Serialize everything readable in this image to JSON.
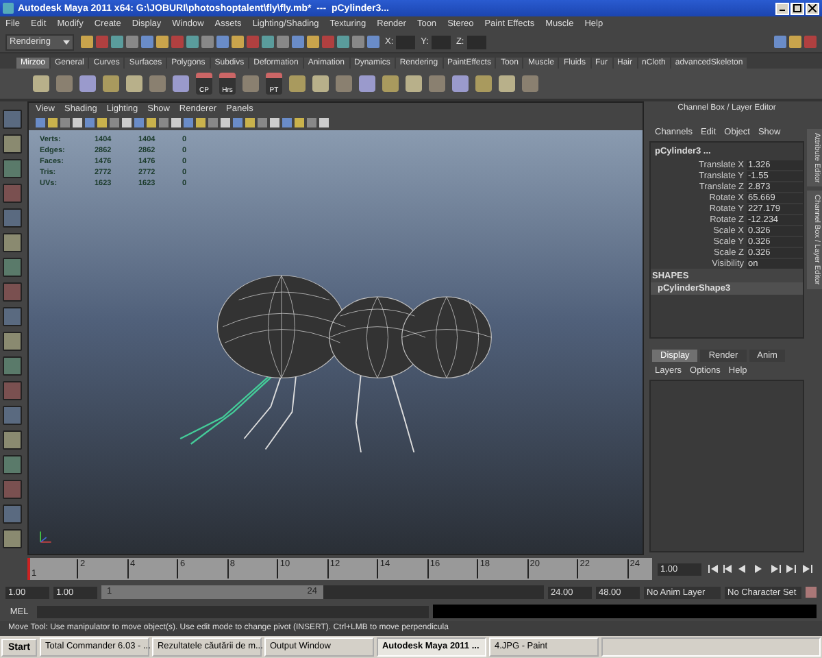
{
  "window": {
    "title": "Autodesk Maya 2011 x64: G:\\JOBURI\\photoshoptalent\\fly\\fly.mb*  ---  pCylinder3..."
  },
  "menu": [
    "File",
    "Edit",
    "Modify",
    "Create",
    "Display",
    "Window",
    "Assets",
    "Lighting/Shading",
    "Texturing",
    "Render",
    "Toon",
    "Stereo",
    "Paint Effects",
    "Muscle",
    "Help"
  ],
  "status_line": {
    "menu_set": "Rendering",
    "x_label": "X:",
    "y_label": "Y:",
    "z_label": "Z:"
  },
  "shelf": {
    "tabs": [
      {
        "label": "Mirzoo",
        "selected": true
      },
      {
        "label": "General",
        "selected": false
      },
      {
        "label": "Curves",
        "selected": false
      },
      {
        "label": "Surfaces",
        "selected": false
      },
      {
        "label": "Polygons",
        "selected": false
      },
      {
        "label": "Subdivs",
        "selected": false
      },
      {
        "label": "Deformation",
        "selected": false
      },
      {
        "label": "Animation",
        "selected": false
      },
      {
        "label": "Dynamics",
        "selected": false
      },
      {
        "label": "Rendering",
        "selected": false
      },
      {
        "label": "PaintEffects",
        "selected": false
      },
      {
        "label": "Toon",
        "selected": false
      },
      {
        "label": "Muscle",
        "selected": false
      },
      {
        "label": "Fluids",
        "selected": false
      },
      {
        "label": "Fur",
        "selected": false
      },
      {
        "label": "Hair",
        "selected": false
      },
      {
        "label": "nCloth",
        "selected": false
      },
      {
        "label": "advancedSkeleton",
        "selected": false
      }
    ],
    "button_labels": [
      "CP",
      "Hrs",
      "PT"
    ]
  },
  "viewport": {
    "menu": [
      "View",
      "Shading",
      "Lighting",
      "Show",
      "Renderer",
      "Panels"
    ],
    "stats": [
      {
        "name": "Verts:",
        "values": [
          "1404",
          "1404",
          "0"
        ]
      },
      {
        "name": "Edges:",
        "values": [
          "2862",
          "2862",
          "0"
        ]
      },
      {
        "name": "Faces:",
        "values": [
          "1476",
          "1476",
          "0"
        ]
      },
      {
        "name": "Tris:",
        "values": [
          "2772",
          "2772",
          "0"
        ]
      },
      {
        "name": "UVs:",
        "values": [
          "1623",
          "1623",
          "0"
        ]
      }
    ]
  },
  "channel_box": {
    "title": "Channel Box / Layer Editor",
    "menu": [
      "Channels",
      "Edit",
      "Object",
      "Show"
    ],
    "object": "pCylinder3 ...",
    "channels": [
      {
        "name": "Translate X",
        "value": "1.326"
      },
      {
        "name": "Translate Y",
        "value": "-1.55"
      },
      {
        "name": "Translate Z",
        "value": "2.873"
      },
      {
        "name": "Rotate X",
        "value": "65.669"
      },
      {
        "name": "Rotate Y",
        "value": "227.179"
      },
      {
        "name": "Rotate Z",
        "value": "-12.234"
      },
      {
        "name": "Scale X",
        "value": "0.326"
      },
      {
        "name": "Scale Y",
        "value": "0.326"
      },
      {
        "name": "Scale Z",
        "value": "0.326"
      },
      {
        "name": "Visibility",
        "value": "on"
      }
    ],
    "shapes_heading": "SHAPES",
    "shape": "pCylinderShape3",
    "side_tabs": [
      "Attribute Editor",
      "Channel Box / Layer Editor"
    ]
  },
  "layer_editor": {
    "tabs": [
      {
        "label": "Display",
        "selected": true
      },
      {
        "label": "Render",
        "selected": false
      },
      {
        "label": "Anim",
        "selected": false
      }
    ],
    "menu": [
      "Layers",
      "Options",
      "Help"
    ]
  },
  "timeline": {
    "level": 0,
    "start": "1",
    "ticks": [
      "2",
      "4",
      "6",
      "8",
      "10",
      "12",
      "14",
      "16",
      "18",
      "20",
      "22",
      "24"
    ],
    "current_frame": "1.00"
  },
  "range": {
    "level": 0.5,
    "start": "1.00",
    "range_start": "1.00",
    "slider_start": "1",
    "slider_end": "24",
    "range_end": "24.00",
    "end": "48.00",
    "anim_layer": "No Anim Layer",
    "character_set": "No Character Set"
  },
  "command_line": {
    "label": "MEL"
  },
  "help_line": "Move Tool: Use manipulator to move object(s). Use edit mode to change pivot (INSERT). Ctrl+LMB to move perpendicula",
  "taskbar": {
    "start": "Start",
    "items": [
      {
        "label": "Total Commander 6.03 - ...",
        "selected": false
      },
      {
        "label": "Rezultatele căutării de m...",
        "selected": false
      },
      {
        "label": "Output Window",
        "selected": false
      },
      {
        "label": "Autodesk Maya 2011 ...",
        "selected": true
      },
      {
        "label": "4.JPG - Paint",
        "selected": false
      }
    ]
  }
}
